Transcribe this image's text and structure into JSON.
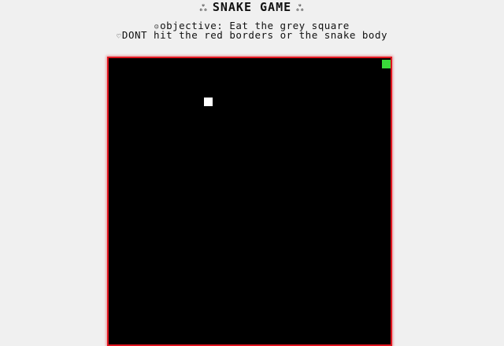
{
  "header": {
    "title": "SNAKE GAME",
    "title_deco": "⚘"
  },
  "instructions": {
    "objective": "objective: Eat the grey square",
    "warning": "DONT hit the red borders or the snake body",
    "bullet_icon_1": "smiley-icon",
    "bullet_icon_2": "heart-icon"
  },
  "game": {
    "border_color": "#e0141e",
    "board_color": "#000000",
    "food_color": "#ffffff",
    "snake_color": "#3ad83a"
  }
}
